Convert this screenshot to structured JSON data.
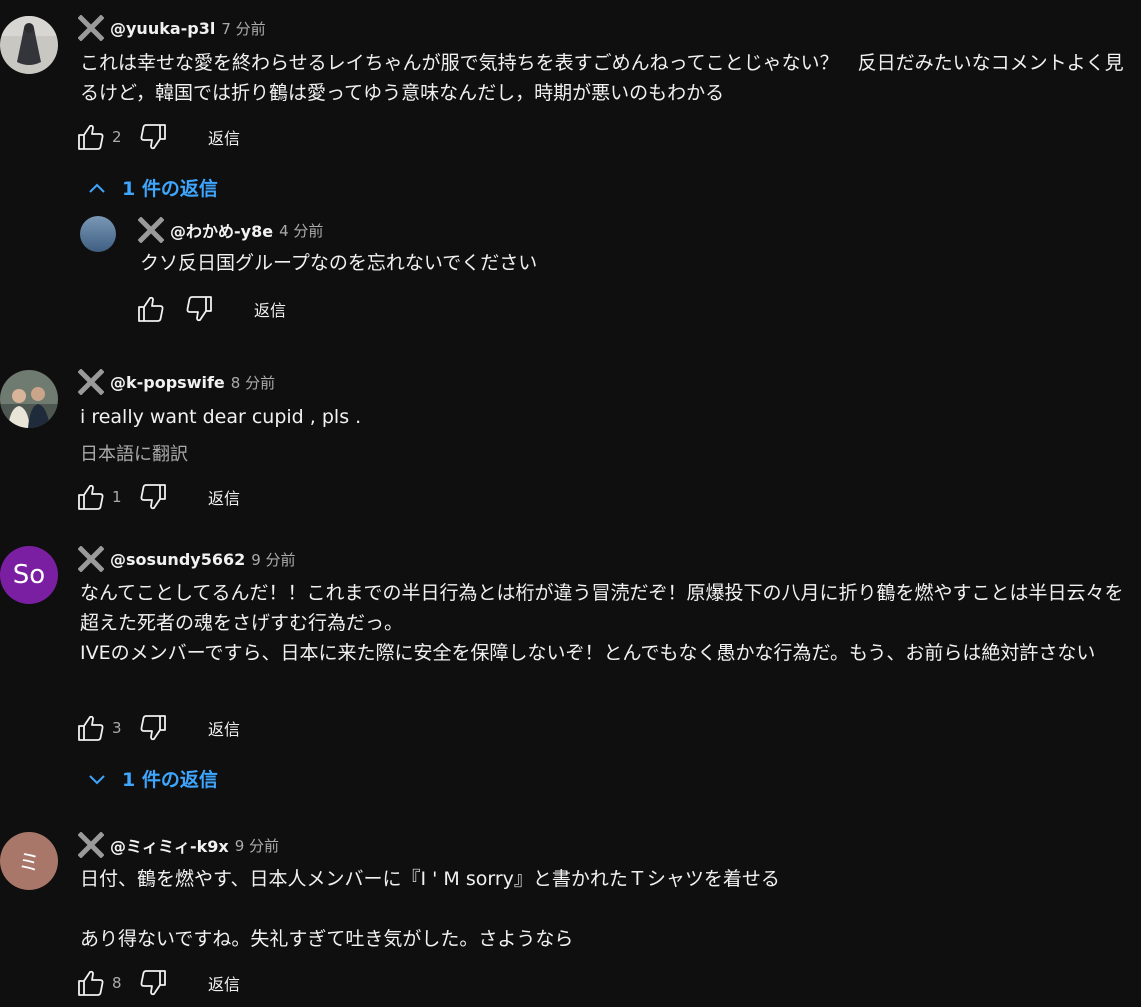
{
  "colors": {
    "background": "#0f0f0f",
    "text": "#f1f1f1",
    "muted": "#aaaaaa",
    "link_blue": "#3ea6ff",
    "avatar_so": "#7b1fa2",
    "avatar_mi": "#a9776a"
  },
  "ui": {
    "reply_label": "返信"
  },
  "comments": [
    {
      "author": "@yuuka-p3l",
      "time": "7 分前",
      "text": "これは幸せな愛を終わらせるレイちゃんが服で気持ちを表すごめんねってことじゃない？　反日だみたいなコメントよく見るけど，韓国では折り鶴は愛ってゆう意味なんだし，時期が悪いのもわかる",
      "likes": "2",
      "replies_toggle": "1 件の返信",
      "replies_expanded": true,
      "replies": [
        {
          "author": "@わかめ-y8e",
          "time": "4 分前",
          "text": "クソ反日国グループなのを忘れないでください",
          "likes": ""
        }
      ]
    },
    {
      "author": "@k-popswife",
      "time": "8 分前",
      "text": "i really want dear cupid , pls .",
      "translate": "日本語に翻訳",
      "likes": "1"
    },
    {
      "author": "@sosundy5662",
      "time": "9 分前",
      "avatar_letter": "So",
      "text": "なんてことしてるんだ！！これまでの半日行為とは桁が違う冒涜だぞ！原爆投下の八月に折り鶴を燃やすことは半日云々を超えた死者の魂をさげすむ行為だっ。\nIVEのメンバーですら、日本に来た際に安全を保障しないぞ！とんでもなく愚かな行為だ。もう、お前らは絶対許さない",
      "likes": "3",
      "replies_toggle": "1 件の返信",
      "replies_expanded": false
    },
    {
      "author": "@ミィミィ-k9x",
      "time": "9 分前",
      "avatar_letter": "ミ",
      "text": "日付、鶴を燃やす、日本人メンバーに『I ' M sorry』と書かれたＴシャツを着せる\n\nあり得ないですね。失礼すぎて吐き気がした。さようなら",
      "likes": "8"
    }
  ]
}
